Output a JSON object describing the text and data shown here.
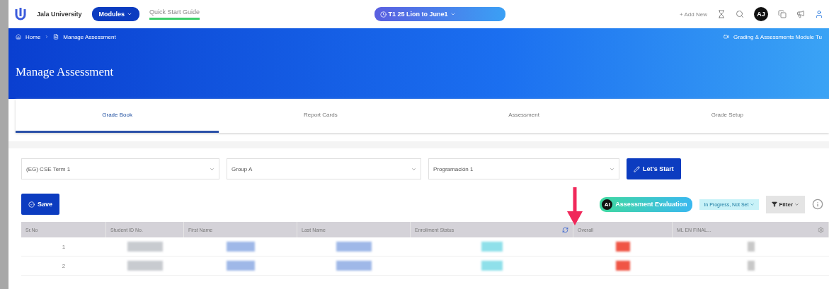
{
  "topbar": {
    "brand": "Jala University",
    "modules": "Modules",
    "guide": "Quick Start Guide",
    "term": "T1 25 Lion to June1",
    "add_new": "+ Add New",
    "avatar": "AJ"
  },
  "breadcrumb": {
    "items": [
      "Home",
      "Manage Assessment"
    ],
    "help": "Grading & Assessments Module Tu"
  },
  "title": "Manage Assessment",
  "tabs": [
    {
      "label": "Grade Book",
      "selected": true
    },
    {
      "label": "Report Cards",
      "selected": false
    },
    {
      "label": "Assessment",
      "selected": false
    },
    {
      "label": "Grade Setup",
      "selected": false
    }
  ],
  "filters": [
    {
      "value": "(EG) CSE Term 1"
    },
    {
      "value": "Group A"
    },
    {
      "value": "Programación 1"
    }
  ],
  "start_button": "Let's Start",
  "save_button": "Save",
  "evaluation": {
    "avatar": "AI",
    "label": "Assessment Evaluation"
  },
  "status_select": "In Progress, Not Set",
  "filter_button": "Filter",
  "table": {
    "columns": [
      {
        "label": "Sr.No",
        "kind": "text"
      },
      {
        "label": "Student ID No.",
        "kind": "text"
      },
      {
        "label": "First Name",
        "kind": "text"
      },
      {
        "label": "Last Name",
        "kind": "text"
      },
      {
        "label": "Enrollment Status",
        "kind": "refresh"
      },
      {
        "label": "Overall",
        "kind": "text"
      },
      {
        "label": "ML EN FINAL...",
        "kind": "settings"
      }
    ],
    "rows": [
      {
        "sr": "1"
      },
      {
        "sr": "2"
      }
    ]
  }
}
